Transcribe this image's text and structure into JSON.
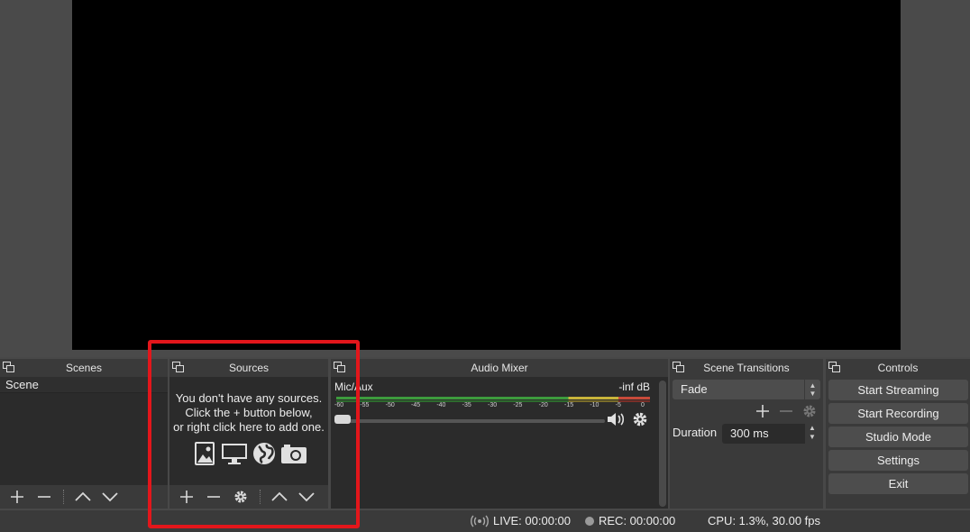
{
  "docks": {
    "scenes": {
      "title": "Scenes",
      "items": [
        "Scene"
      ]
    },
    "sources": {
      "title": "Sources",
      "empty_line1": "You don't have any sources.",
      "empty_line2": "Click the + button below,",
      "empty_line3": "or right click here to add one."
    },
    "mixer": {
      "title": "Audio Mixer",
      "channel": {
        "name": "Mic/Aux",
        "level": "-inf dB",
        "volume_fraction": 0
      },
      "ticks": [
        "-60",
        "-55",
        "-50",
        "-45",
        "-40",
        "-35",
        "-30",
        "-25",
        "-20",
        "-15",
        "-10",
        "-5",
        "0"
      ]
    },
    "transitions": {
      "title": "Scene Transitions",
      "selected": "Fade",
      "duration_label": "Duration",
      "duration_value": "300 ms"
    },
    "controls": {
      "title": "Controls",
      "buttons": [
        "Start Streaming",
        "Start Recording",
        "Studio Mode",
        "Settings",
        "Exit"
      ]
    }
  },
  "status": {
    "live": "LIVE: 00:00:00",
    "rec": "REC: 00:00:00",
    "cpu": "CPU: 1.3%, 30.00 fps"
  },
  "colors": {
    "highlight": "#e3161b",
    "meter_green": "#3d9b3d",
    "meter_yellow": "#c8b43a",
    "meter_red": "#c84a3a"
  },
  "icons": {
    "float": "float-window-icon",
    "add": "plus-icon",
    "remove": "minus-icon",
    "up": "chevron-up-icon",
    "down": "chevron-down-icon",
    "settings": "gear-icon",
    "volume": "speaker-icon"
  }
}
